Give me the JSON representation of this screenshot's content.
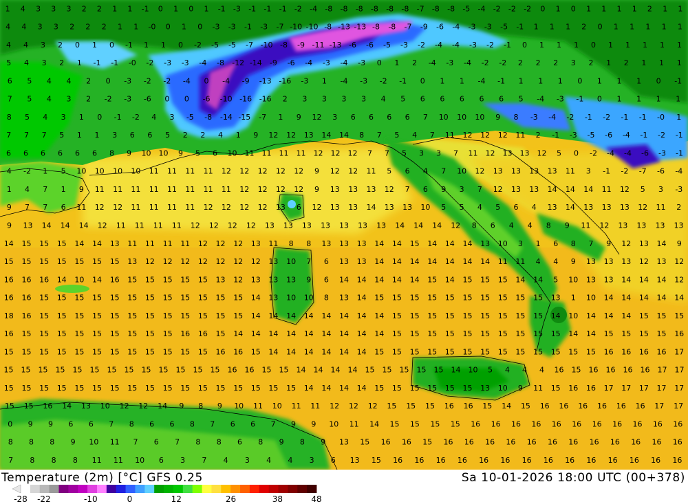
{
  "title": {
    "left": "Temperature (2m) [°C] GFS 0.25",
    "right": "Sa 10-01-2026 18:00 UTC (00+378)"
  },
  "legend": {
    "tick_labels": [
      "-28",
      "-22",
      "-10",
      "0",
      "12",
      "26",
      "38",
      "48"
    ],
    "colors": [
      "#ffffff",
      "#d6d6d6",
      "#b8b8b8",
      "#9a9a9a",
      "#800080",
      "#a000a0",
      "#c000c0",
      "#e040e0",
      "#ff80ff",
      "#4000a0",
      "#2020e0",
      "#3060ff",
      "#40a0ff",
      "#60d0ff",
      "#00a000",
      "#00b400",
      "#00c800",
      "#40e040",
      "#80ff00",
      "#ffff40",
      "#ffe040",
      "#ffc000",
      "#ff9000",
      "#ff6000",
      "#ff2000",
      "#e00000",
      "#c00000",
      "#a00000",
      "#800000",
      "#600000",
      "#400000"
    ]
  },
  "map": {
    "label_rows": [
      "1 4 3 3 3 2 2 1 1 -1 0 1 0 1 -1 -3 -1 -1 -1 -2 -4 -8 -8 -8 -8 -8 -8 -7 -8 -8 -5 -4 -2 -2 -2 0 1 0 1 1 1 1 2 1 1",
      "4 4 3 3 2 2 2 1 1 -0 0 1 0 -3 -3 -1 -3 -7 -10 -10 -8 -13 -13 -8 -8 -7 -9 -6 -4 -3 -3 -5 -1 1 1 1 2 0 1 1 1 1 1",
      "4 4 3 2 0 1 0 -1 1 1 0 -2 -5 -5 -7 -10 -8 -9 -11 -13 -6 -6 -5 -3 -2 -4 -4 -3 -2 -1 0 1 1 1 0 1 1 1 1 1",
      "5 4 3 2 1 -1 -1 -0 -2 -3 -3 -4 -8 -12 -14 -9 -6 -4 -3 -4 -3 0 1 2 -4 -3 -4 -2 -2 2 2 2 3 2 1 2 1 1 1",
      "6 5 4 4 2 0 -3 -2 -2 -4 0 -4 -9 -13 -16 -3 1 -4 -3 -2 -1 0 1 1 -4 -1 1 1 1 0 1 1 1 0 -1",
      "7 5 4 3 2 -2 -3 -6 0 0 -6 -10 -16 -16 2 3 3 3 3 4 5 6 6 6 6 6 5 -4 -3 -1 0 1 1 1 1",
      "8 5 4 3 1 0 -1 -2 4 3 -5 -8 -14 -15 -7 1 9 12 3 6 6 6 6 7 10 10 10 9 8 -3 -4 -2 -1 -2 -1 -1 -0 1",
      "7 7 7 5 1 1 3 6 6 5 2 2 4 1 9 12 12 13 14 14 8 7 5 4 7 11 12 12 12 11 2 -1 -3 -5 -6 -4 -1 -2 -1",
      "6 6 6 6 6 6 8 9 10 10 9 5 6 10 11 11 11 11 12 12 12 7 7 5 3 3 7 11 12 13 13 12 5 0 -2 -4 -4 -6 -3 -1",
      "4 -2 1 5 10 10 10 10 11 11 11 11 12 12 12 12 12 9 12 12 11 5 6 4 7 10 12 13 13 13 13 11 3 -1 -2 -7 -6 -4",
      "1 4 7 1 9 11 11 11 11 11 11 11 11 12 12 12 12 9 13 13 13 12 7 6 9 3 7 12 13 13 14 14 14 11 12 5 3 -3",
      "9 7 7 6 11 12 12 11 11 11 11 12 12 12 12 13 6 12 13 13 14 13 13 10 5 5 4 5 6 4 13 14 13 13 13 12 11 2",
      "9 13 14 14 14 12 11 11 11 11 12 12 12 12 13 13 13 13 13 13 13 14 14 14 12 8 6 4 4 8 9 11 12 13 13 13 13",
      "14 15 15 15 14 14 13 11 11 11 11 12 12 12 13 11 8 8 13 13 13 14 14 15 14 14 14 13 10 3 1 6 8 7 9 12 13 14 9",
      "15 15 15 15 15 15 15 13 12 12 12 12 12 12 12 13 10 7 6 13 13 14 14 14 14 14 14 14 11 11 4 4 9 13 13 13 12 13 12",
      "16 16 16 14 10 14 16 15 15 15 15 15 13 12 13 13 13 9 6 14 14 14 14 14 15 14 15 15 15 14 14 5 10 13 13 14 14 14 12",
      "16 16 15 15 15 15 15 15 15 15 15 15 15 15 14 13 10 10 8 13 14 15 15 15 15 15 15 15 15 15 15 13 1 10 14 14 14 14 14",
      "18 16 15 15 15 15 15 15 15 15 15 15 15 15 14 14 14 14 14 14 14 14 15 15 15 15 15 15 15 15 15 14 10 14 14 14 15 15 15",
      "16 15 15 15 15 15 15 15 15 15 16 16 15 14 14 14 14 14 14 14 14 14 15 15 15 15 15 15 15 15 15 15 14 14 15 15 15 15 16",
      "15 15 15 15 15 15 15 15 15 15 15 15 16 16 15 14 14 14 14 14 14 15 15 15 15 15 15 15 15 15 15 15 15 15 16 16 16 16 17",
      "15 15 15 15 15 15 15 15 15 15 15 15 15 16 16 15 15 14 14 14 14 15 15 15 15 15 14 10 5 4 4 4 16 15 16 16 16 16 17 17",
      "15 15 15 15 15 15 15 15 15 15 15 15 15 15 15 15 15 14 14 14 14 15 15 15 15 15 15 13 10 9 11 15 16 16 17 17 17 17 17",
      "15 15 16 14 13 10 12 12 14 9 8 9 10 11 10 11 11 12 12 12 15 15 15 16 16 15 14 15 16 16 16 16 16 16 17 17",
      "0 9 9 6 6 7 8 6 6 8 7 6 6 7 9 9 10 11 14 15 15 15 15 16 16 16 16 16 16 16 16 16 16 16",
      "8 8 8 9 10 11 7 6 7 8 8 6 8 9 8 9 13 15 16 16 15 16 16 16 16 16 16 16 16 16 16 16 16",
      "7 8 8 8 11 11 10 6 3 7 4 3 4 4 3 6 13 15 16 16 16 16 16 16 16 16 16 16 16 16 16 16"
    ]
  }
}
